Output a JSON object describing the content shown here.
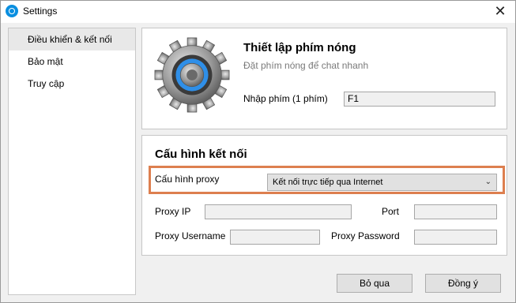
{
  "window": {
    "title": "Settings",
    "close_symbol": "✕"
  },
  "sidebar": {
    "items": [
      {
        "label": "Điều khiển & kết nối"
      },
      {
        "label": "Bảo mật"
      },
      {
        "label": "Truy cập"
      }
    ]
  },
  "hotkey": {
    "title": "Thiết lập phím nóng",
    "subtitle": "Đặt phím nóng để chat nhanh",
    "input_label": "Nhập phím (1 phím)",
    "input_value": "F1",
    "icon": "gear-icon"
  },
  "connection": {
    "title": "Cấu hình kết nối",
    "proxy_label": "Cấu hình proxy",
    "proxy_selected": "Kết nối trực tiếp qua Internet",
    "proxy_ip_label": "Proxy IP",
    "proxy_ip_value": "",
    "port_label": "Port",
    "port_value": "",
    "username_label": "Proxy Username",
    "username_value": "",
    "password_label": "Proxy Password",
    "password_value": ""
  },
  "buttons": {
    "skip": "Bỏ qua",
    "agree": "Đồng ý"
  },
  "colors": {
    "highlight": "#dd7f4f",
    "app_icon": "#0a8fe0",
    "gear_ring": "#2f8fe8"
  }
}
